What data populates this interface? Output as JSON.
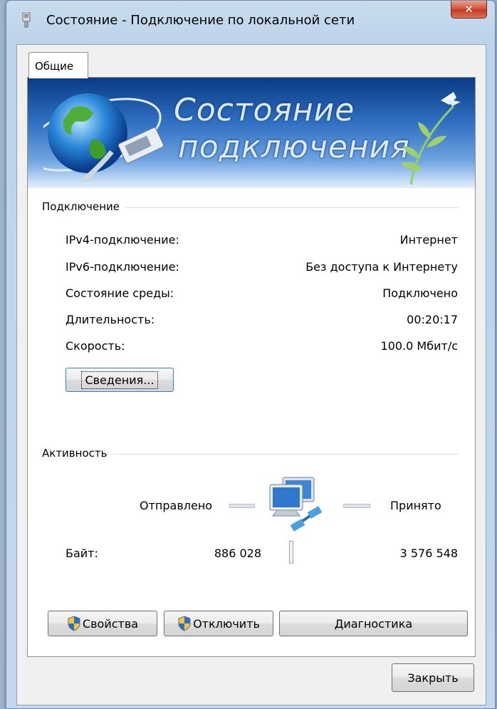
{
  "window": {
    "title": "Состояние - Подключение по локальной сети",
    "close_glyph": "✕"
  },
  "tabs": [
    {
      "label": "Общие",
      "active": true
    }
  ],
  "banner": {
    "line1": "Состояние",
    "line2": "подключения"
  },
  "connection": {
    "section_label": "Подключение",
    "rows": [
      {
        "label": "IPv4-подключение:",
        "value": "Интернет"
      },
      {
        "label": "IPv6-подключение:",
        "value": "Без доступа к Интернету"
      },
      {
        "label": "Состояние среды:",
        "value": "Подключено"
      },
      {
        "label": "Длительность:",
        "value": "00:20:17"
      },
      {
        "label": "Скорость:",
        "value": "100.0 Мбит/с"
      }
    ],
    "details_button": "Сведения..."
  },
  "activity": {
    "section_label": "Активность",
    "sent_label": "Отправлено",
    "received_label": "Принято",
    "bytes_label": "Байт:",
    "bytes_sent": "886 028",
    "bytes_received": "3 576 548"
  },
  "buttons": {
    "properties": "Свойства",
    "disconnect": "Отключить",
    "diagnose": "Диагностика",
    "close": "Закрыть"
  },
  "icons": {
    "app": "network-adapter-icon",
    "banner_globe": "globe-icon",
    "banner_bird": "bird-icon",
    "activity": "network-computers-icon",
    "shield": "uac-shield-icon"
  },
  "colors": {
    "close_red": "#c23a22",
    "banner_blue": "#2f6fc1",
    "window_frame": "#c9dcee"
  }
}
